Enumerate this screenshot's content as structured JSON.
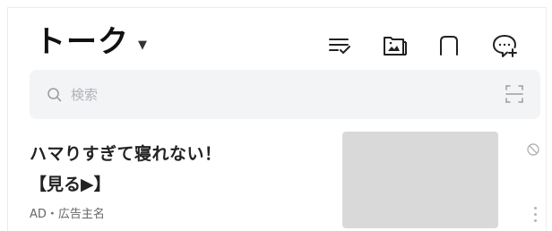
{
  "header": {
    "title": "トーク",
    "dropdown_icon": "caret-down-icon",
    "actions": [
      {
        "name": "edit-list-icon"
      },
      {
        "name": "album-folder-icon"
      },
      {
        "name": "open-chat-icon"
      },
      {
        "name": "new-chat-icon"
      }
    ]
  },
  "search": {
    "placeholder": "検索",
    "icon": "search-icon",
    "scan_icon": "qr-scan-icon"
  },
  "ad": {
    "title": "ハマりすぎて寝れない！",
    "subtitle": "【見る▶】",
    "label": "AD・広告主名",
    "block_icon": "block-icon",
    "more_icon": "more-vertical-icon"
  },
  "colors": {
    "search_background": "#f3f4f6",
    "thumbnail": "#d9d9d9",
    "icon_gray": "#b5b5b5",
    "text": "#111111"
  }
}
